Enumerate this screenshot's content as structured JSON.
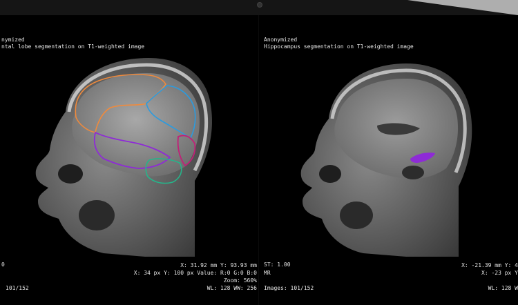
{
  "left_viewer": {
    "anon_label": "nymized",
    "description": "ntal lobe segmentation on T1-weighted image",
    "corner_label": "0",
    "coords_mm": "X: 31.92 mm Y: 93.93 mm",
    "coords_px": "X: 34 px Y: 100 px Value: R:0 G:0 B:0",
    "zoom": "Zoom: 560%",
    "window_level": "WL: 128 WW: 256",
    "images": "101/152"
  },
  "right_viewer": {
    "anon_label": "Anonymized",
    "description": "Hippocampus segmentation on T1-weighted image",
    "slice_thickness": "ST: 1.00",
    "modality": "MR",
    "images": "Images: 101/152",
    "coords_mm": "X: -21.39 mm Y: 4",
    "coords_px": "X: -23 px Y",
    "window_level": "WL: 128 W"
  },
  "colors": {
    "frontal": "#f08a3c",
    "parietal": "#2a9be0",
    "temporal": "#8e2bd6",
    "occipital": "#c21f78",
    "cerebellum": "#26b48a",
    "hippocampus": "#8e2bd6"
  }
}
